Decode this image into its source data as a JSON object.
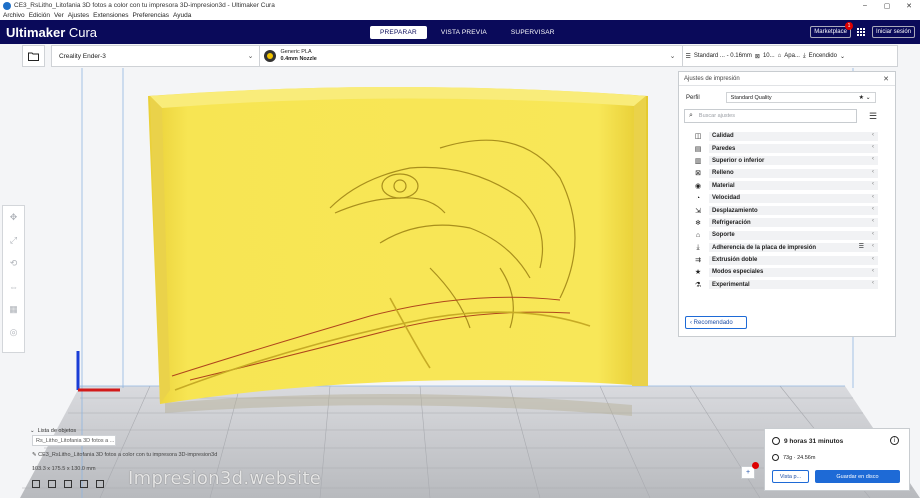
{
  "window": {
    "title": "CE3_RsLitho_Litofania 3D fotos a color con tu impresora 3D-impresion3d - Ultimaker Cura",
    "minimize": "–",
    "restore": "▢",
    "close": "✕"
  },
  "menu": [
    "Archivo",
    "Edición",
    "Ver",
    "Ajustes",
    "Extensiones",
    "Preferencias",
    "Ayuda"
  ],
  "header": {
    "brand_bold": "Ultimaker",
    "brand_light": " Cura",
    "stages": [
      "PREPARAR",
      "VISTA PREVIA",
      "SUPERVISAR"
    ],
    "marketplace": "Marketplace",
    "marketplace_badge": "1",
    "signin": "Iniciar sesión"
  },
  "toolbar": {
    "printer": "Creality Ender-3",
    "material_name": "Generic PLA",
    "nozzle": "0.4mm Nozzle",
    "profile_summary": "Standard ... - 0.16mm",
    "infill": "10...",
    "support": "Apa...",
    "adhesion": "Encendido"
  },
  "panel": {
    "title": "Ajustes de impresión",
    "close": "✕",
    "profile_label": "Perfil",
    "profile_value": "Standard Quality",
    "search_placeholder": "Buscar ajustes",
    "categories": [
      {
        "icon": "◫",
        "label": "Calidad"
      },
      {
        "icon": "▤",
        "label": "Paredes"
      },
      {
        "icon": "▥",
        "label": "Superior o inferior"
      },
      {
        "icon": "⊠",
        "label": "Relleno"
      },
      {
        "icon": "◉",
        "label": "Material"
      },
      {
        "icon": "◔",
        "label": "Velocidad"
      },
      {
        "icon": "⇲",
        "label": "Desplazamiento"
      },
      {
        "icon": "❄",
        "label": "Refrigeración"
      },
      {
        "icon": "⌂",
        "label": "Soporte"
      },
      {
        "icon": "⤓",
        "label": "Adherencia de la placa de impresión"
      },
      {
        "icon": "⇉",
        "label": "Extrusión doble"
      },
      {
        "icon": "★",
        "label": "Modos especiales"
      },
      {
        "icon": "⚗",
        "label": "Experimental"
      }
    ],
    "recommended": "Recomendado"
  },
  "objects": {
    "list_label": "Lista de objetos",
    "selected_object": "Rs_Litho_Litofania 3D fotos a ...",
    "file_name": "CE3_RsLitho_Litofania 3D fotos a color con tu impresora 3D-impresion3d",
    "dimensions": "103.3 x 175.5 x 130.0 mm"
  },
  "watermark": "Impresion3d.website",
  "summary": {
    "time": "9 horas 31 minutos",
    "material": "73g · 24.56m",
    "preview_button": "Vista p...",
    "save_button": "Guardar en disco"
  },
  "colors": {
    "header_bg": "#0a0a5a",
    "accent_blue": "#1e6ad6",
    "model_yellow": "#f6e24e",
    "badge_red": "#dd0000"
  }
}
